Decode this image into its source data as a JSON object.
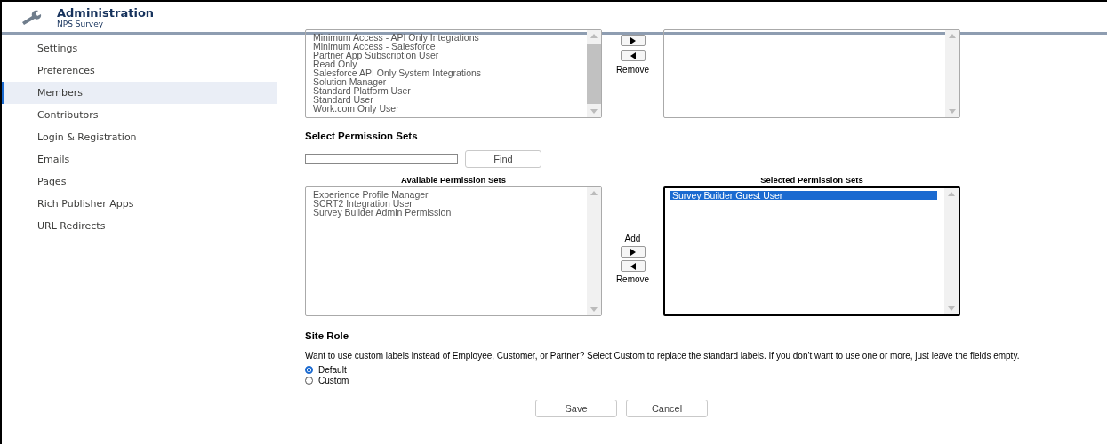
{
  "header": {
    "title": "Administration",
    "subtitle": "NPS Survey"
  },
  "sidebar": {
    "items": [
      {
        "label": "Settings",
        "selected": false
      },
      {
        "label": "Preferences",
        "selected": false
      },
      {
        "label": "Members",
        "selected": true
      },
      {
        "label": "Contributors",
        "selected": false
      },
      {
        "label": "Login & Registration",
        "selected": false
      },
      {
        "label": "Emails",
        "selected": false
      },
      {
        "label": "Pages",
        "selected": false
      },
      {
        "label": "Rich Publisher Apps",
        "selected": false
      },
      {
        "label": "URL Redirects",
        "selected": false
      }
    ]
  },
  "profiles": {
    "available": [
      {
        "label": "Minimum Access - API Only Integrations",
        "selected": false
      },
      {
        "label": "Minimum Access - Salesforce",
        "selected": false
      },
      {
        "label": "Partner App Subscription User",
        "selected": false
      },
      {
        "label": "Read Only",
        "selected": false
      },
      {
        "label": "Salesforce API Only System Integrations",
        "selected": false
      },
      {
        "label": "Solution Manager",
        "selected": false
      },
      {
        "label": "Standard Platform User",
        "selected": false
      },
      {
        "label": "Standard User",
        "selected": false
      },
      {
        "label": "Work.com Only User",
        "selected": false
      }
    ],
    "remove_label": "Remove"
  },
  "permission_sets": {
    "title": "Select Permission Sets",
    "find_button": "Find",
    "available_title": "Available Permission Sets",
    "available": [
      {
        "label": "Experience Profile Manager",
        "selected": false
      },
      {
        "label": "SCRT2 Integration User",
        "selected": false
      },
      {
        "label": "Survey Builder Admin Permission",
        "selected": false
      }
    ],
    "add_label": "Add",
    "remove_label": "Remove",
    "selected_title": "Selected Permission Sets",
    "selected": [
      {
        "label": "Survey Builder Guest User",
        "selected": true
      }
    ]
  },
  "site_role": {
    "title": "Site Role",
    "description": "Want to use custom labels instead of Employee, Customer, or Partner? Select Custom to replace the standard labels. If you don't want to use one or more, just leave the fields empty.",
    "options": [
      {
        "label": "Default",
        "selected": true
      },
      {
        "label": "Custom",
        "selected": false
      }
    ]
  },
  "buttons": [
    "Save",
    "Cancel"
  ]
}
